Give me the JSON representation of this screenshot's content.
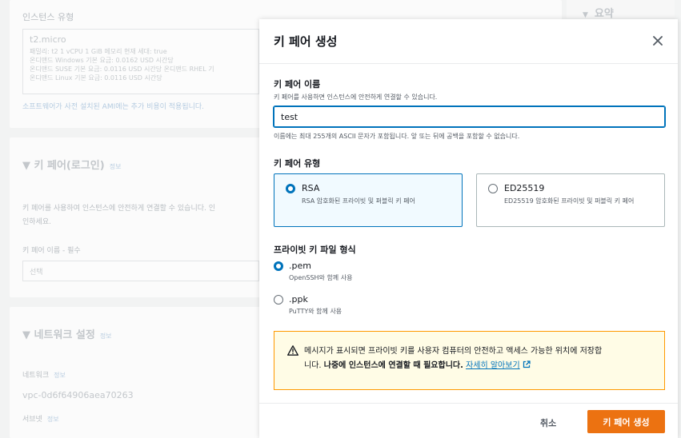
{
  "background": {
    "instance_type": {
      "title": "인스턴스 유형",
      "selected": "t2.micro",
      "details": [
        "패밀리: t2    1 vCPU    1 GiB 메모리    현재 세대: true",
        "온디맨드 Windows 기본 요금: 0.0162 USD 시간당",
        "온디맨드 SUSE 기본 요금: 0.0116 USD 시간당    온디맨드 RHEL 기",
        "온디맨드 Linux 기본 요금: 0.0116 USD 시간당"
      ],
      "notice": "소프트웨어가 사전 설치된 AMI에는 추가 비용이 적용됩니다."
    },
    "key_pair_section": {
      "title": "▼  키 페어(로그인)",
      "info": "정보",
      "description": "키 페어를 사용하여 인스턴스에 안전하게 연결할 수 있습니다. 인",
      "description2": "인하세요.",
      "field_label": "키 페어 이름 - 필수",
      "field_placeholder": "선택"
    },
    "network_section": {
      "title": "▼  네트워크 설정",
      "info": "정보",
      "network_label": "네트워크",
      "network_info": "정보",
      "network_value": "vpc-0d6f64906aea70263",
      "subnet_label": "서브넷",
      "subnet_info": "정보"
    },
    "summary": {
      "arrow": "▼",
      "title": "요약"
    }
  },
  "modal": {
    "title": "키 페어 생성",
    "close_icon": "close-icon",
    "name_field": {
      "label": "키 페어 이름",
      "description": "키 페어를 사용하면 인스턴스에 안전하게 연결할 수 있습니다.",
      "value": "test",
      "constraint": "이름에는 최대 255개의 ASCII 문자가 포함됩니다. 앞 또는 뒤에 공백을 포함할 수 없습니다."
    },
    "key_type": {
      "label": "키 페어 유형",
      "options": [
        {
          "title": "RSA",
          "description": "RSA 암호화된 프라이빗 및 퍼블릭 키 페어",
          "selected": true
        },
        {
          "title": "ED25519",
          "description": "ED25519 암호화된 프라이빗 및 퍼블릭 키 페어",
          "selected": false
        }
      ]
    },
    "file_format": {
      "label": "프라이빗 키 파일 형식",
      "options": [
        {
          "title": ".pem",
          "description": "OpenSSH와 함께 사용",
          "selected": true
        },
        {
          "title": ".ppk",
          "description": "PuTTY와 함께 사용",
          "selected": false
        }
      ]
    },
    "warning": {
      "icon": "warning-icon",
      "text_line1": "메시지가 표시되면 프라이빗 키를 사용자 컴퓨터의 안전하고 액세스 가능한 위치에 저장합",
      "text_plain": "니다. ",
      "text_bold": "나중에 인스턴스에 연결할 때 필요합니다.",
      "link": "자세히 알아보기",
      "link_icon": "external-link-icon"
    },
    "footer": {
      "cancel_label": "취소",
      "create_label": "키 페어 생성"
    }
  },
  "colors": {
    "accent": "#0073bb",
    "primary_button": "#ec7211",
    "warning_border": "#ff9900",
    "warning_bg": "#fffce6"
  }
}
